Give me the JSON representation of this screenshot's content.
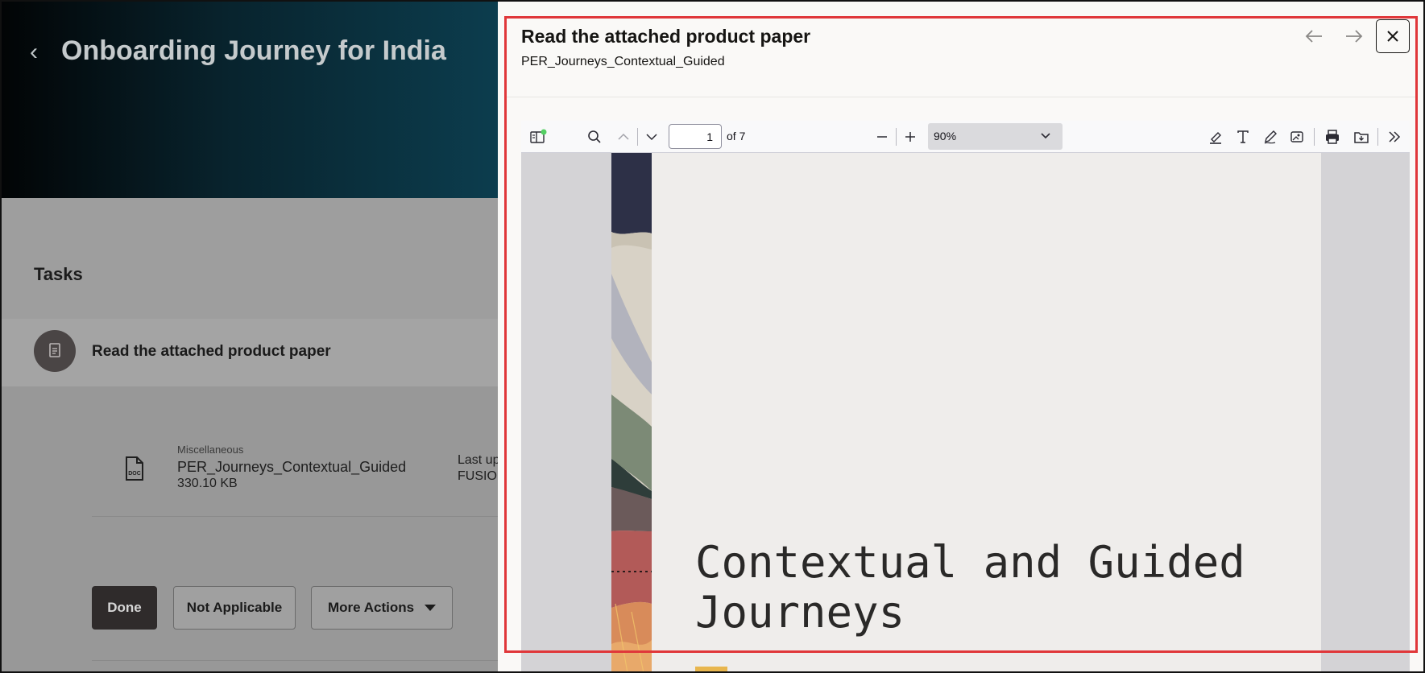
{
  "background": {
    "page_title": "Onboarding Journey for India",
    "tasks_heading": "Tasks",
    "task": {
      "name": "Read the attached product paper"
    },
    "attachment": {
      "category": "Miscellaneous",
      "file_name": "PER_Journeys_Contextual_Guided",
      "size": "330.10 KB",
      "last_updated_line1": "Last up",
      "last_updated_line2": "FUSIO"
    },
    "buttons": {
      "done": "Done",
      "not_applicable": "Not Applicable",
      "more_actions": "More Actions"
    }
  },
  "drawer": {
    "title": "Read the attached product paper",
    "subtitle": "PER_Journeys_Contextual_Guided",
    "icons": {
      "prev": "arrow-left-icon",
      "next": "arrow-right-icon",
      "close": "close-icon"
    }
  },
  "viewer": {
    "page_number": "1",
    "page_count_label": "of 7",
    "zoom": "90%",
    "toolbar_icons": [
      "sidebar-toggle-icon",
      "search-icon",
      "chevron-up-icon",
      "chevron-down-icon",
      "zoom-out-icon",
      "zoom-in-icon",
      "highlight-icon",
      "text-icon",
      "draw-icon",
      "image-icon",
      "print-icon",
      "save-icon",
      "more-tools-icon"
    ],
    "document": {
      "heading_line1": "Contextual and Guided",
      "heading_line2": "Journeys"
    }
  },
  "colors": {
    "highlight": "#e0373a",
    "header_gradient_end": "#0c3d4e",
    "done_button": "#2f2b2b"
  }
}
